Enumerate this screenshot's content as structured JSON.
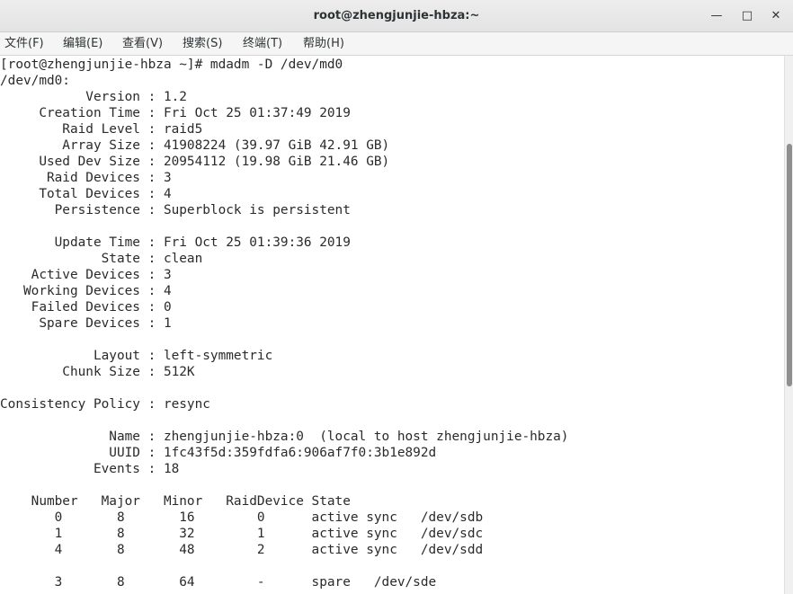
{
  "window": {
    "title": "root@zhengjunjie-hbza:~",
    "minimize_glyph": "—",
    "maximize_glyph": "□",
    "close_glyph": "✕"
  },
  "menu": [
    "文件(F)",
    "编辑(E)",
    "查看(V)",
    "搜索(S)",
    "终端(T)",
    "帮助(H)"
  ],
  "terminal": {
    "lines": [
      "[root@zhengjunjie-hbza ~]# mdadm -D /dev/md0",
      "/dev/md0:",
      "           Version : 1.2",
      "     Creation Time : Fri Oct 25 01:37:49 2019",
      "        Raid Level : raid5",
      "        Array Size : 41908224 (39.97 GiB 42.91 GB)",
      "     Used Dev Size : 20954112 (19.98 GiB 21.46 GB)",
      "      Raid Devices : 3",
      "     Total Devices : 4",
      "       Persistence : Superblock is persistent",
      "",
      "       Update Time : Fri Oct 25 01:39:36 2019",
      "             State : clean",
      "    Active Devices : 3",
      "   Working Devices : 4",
      "    Failed Devices : 0",
      "     Spare Devices : 1",
      "",
      "            Layout : left-symmetric",
      "        Chunk Size : 512K",
      "",
      "Consistency Policy : resync",
      "",
      "              Name : zhengjunjie-hbza:0  (local to host zhengjunjie-hbza)",
      "              UUID : 1fc43f5d:359fdfa6:906af7f0:3b1e892d",
      "            Events : 18",
      "",
      "    Number   Major   Minor   RaidDevice State",
      "       0       8       16        0      active sync   /dev/sdb",
      "       1       8       32        1      active sync   /dev/sdc",
      "       4       8       48        2      active sync   /dev/sdd",
      "",
      "       3       8       64        -      spare   /dev/sde"
    ]
  },
  "colors": {
    "titlebar": "#e6e6e6",
    "menubar": "#f5f5f5",
    "terminal_bg": "#ffffff",
    "terminal_fg": "#2a2a2a",
    "scroll_thumb": "#8f8f8f"
  }
}
